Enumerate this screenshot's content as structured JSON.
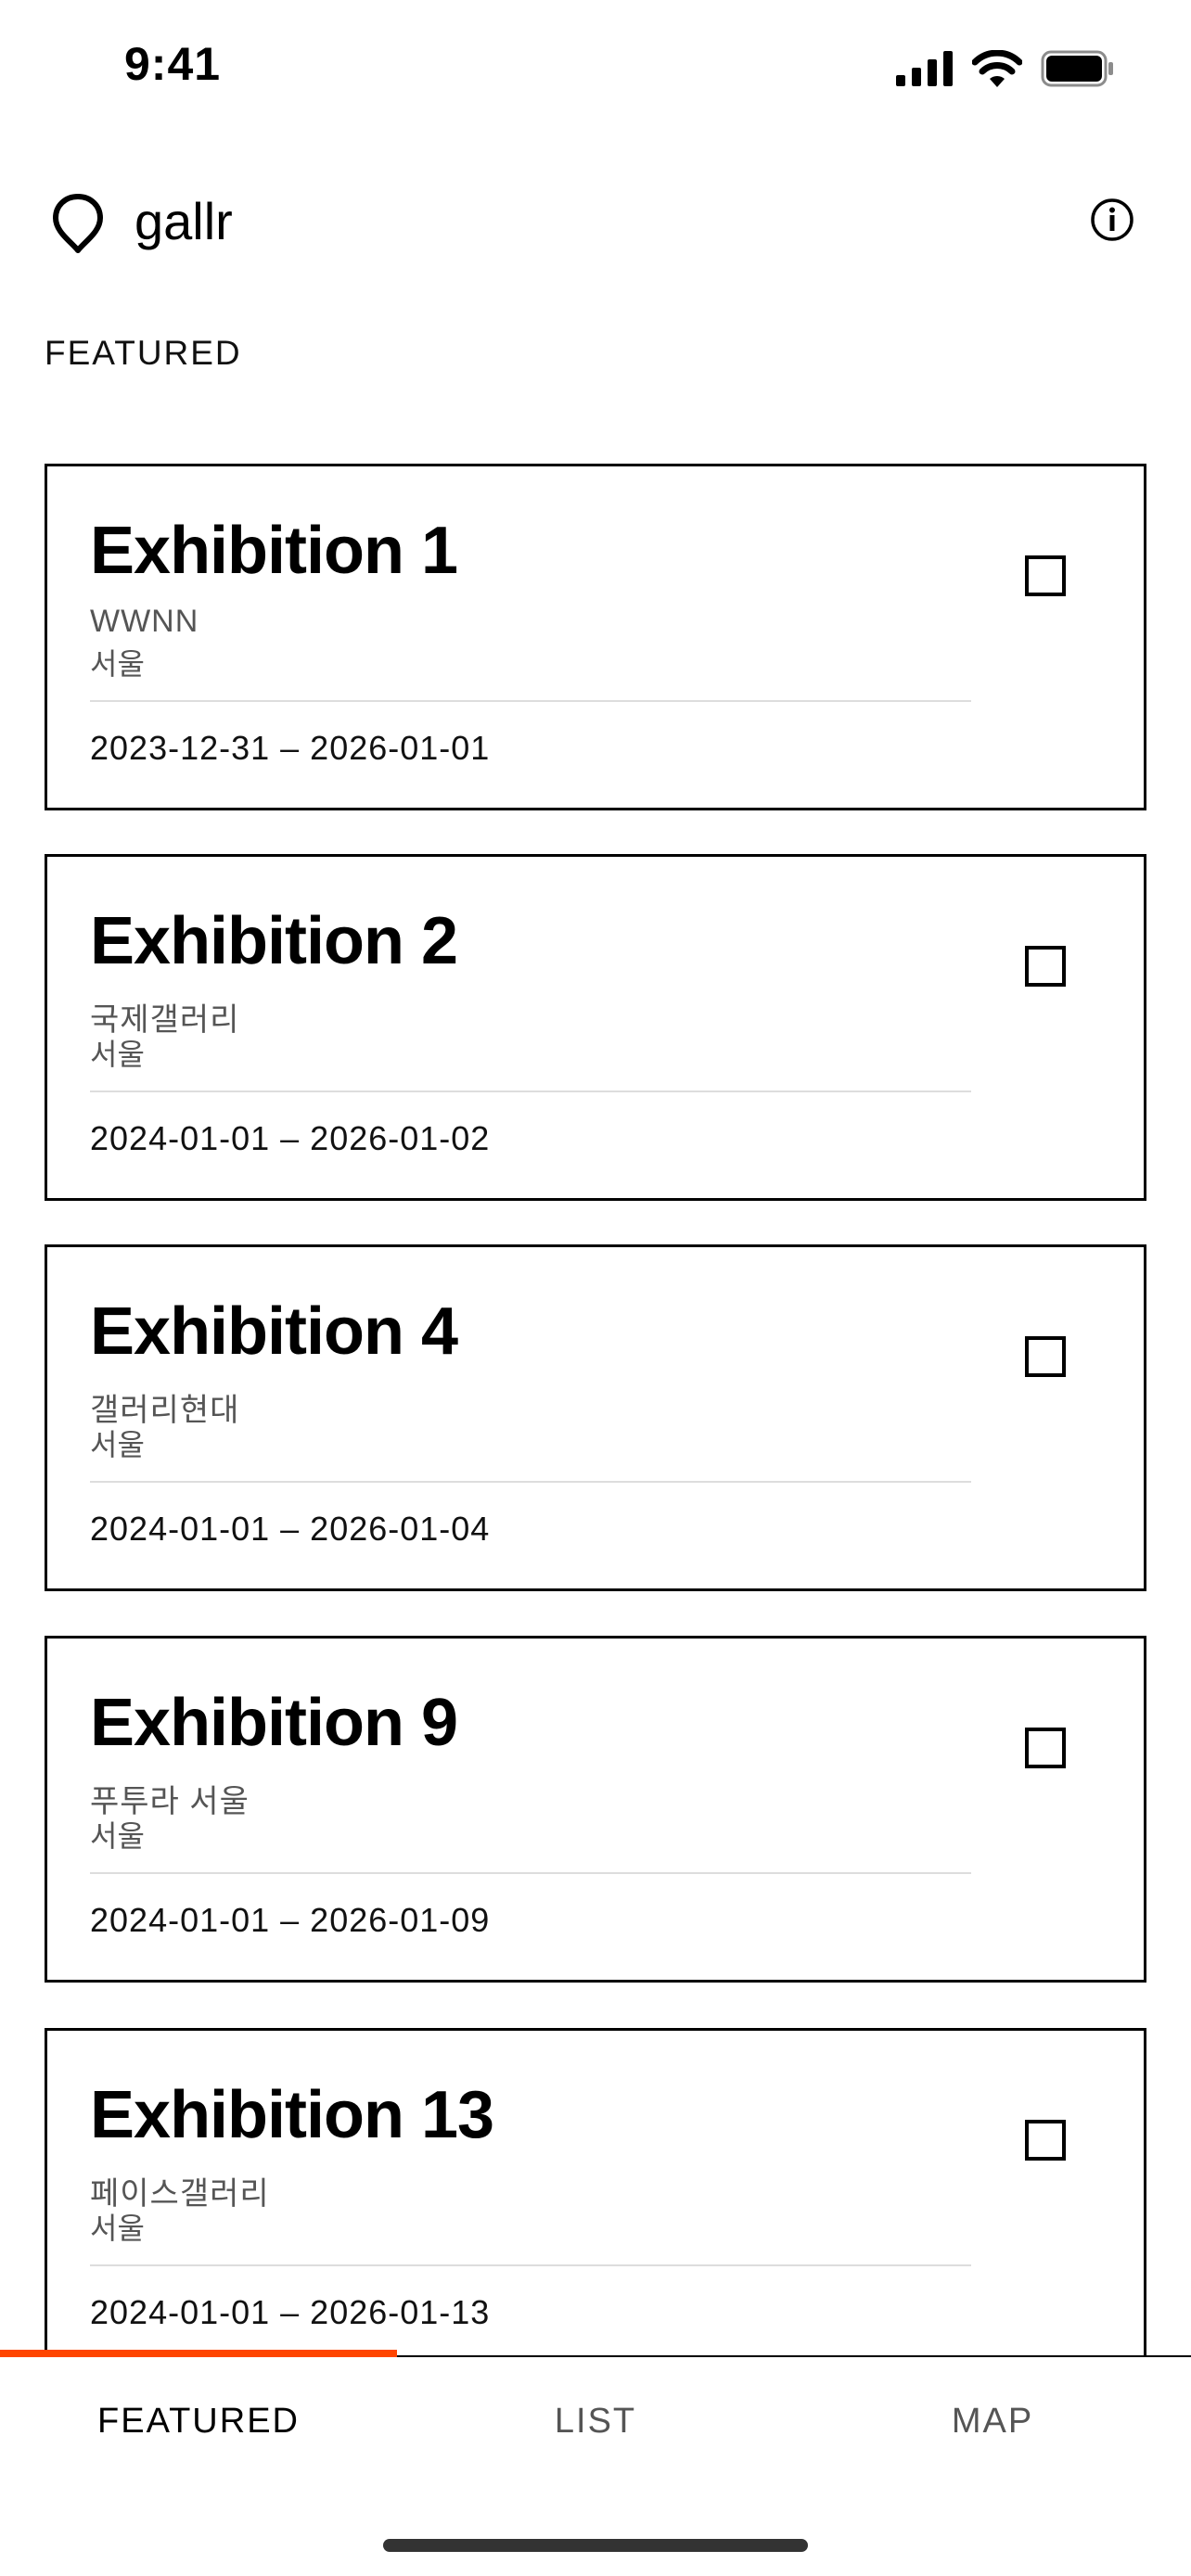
{
  "status_bar": {
    "time": "9:41",
    "icons": [
      "cellular-signal-icon",
      "wifi-icon",
      "battery-icon"
    ]
  },
  "app": {
    "name": "gallr",
    "logo_icon": "location-pin-icon",
    "info_icon": "info-icon"
  },
  "section": {
    "title": "FEATURED"
  },
  "exhibitions": [
    {
      "title": "Exhibition 1",
      "gallery": "WWNN",
      "city": "서울",
      "dates": "2023-12-31 – 2026-01-01",
      "bookmarked": false
    },
    {
      "title": "Exhibition 2",
      "gallery": "국제갤러리",
      "city": "서울",
      "dates": "2024-01-01 – 2026-01-02",
      "bookmarked": false
    },
    {
      "title": "Exhibition 4",
      "gallery": "갤러리현대",
      "city": "서울",
      "dates": "2024-01-01 – 2026-01-04",
      "bookmarked": false
    },
    {
      "title": "Exhibition 9",
      "gallery": "푸투라 서울",
      "city": "서울",
      "dates": "2024-01-01 – 2026-01-09",
      "bookmarked": false
    },
    {
      "title": "Exhibition 13",
      "gallery": "페이스갤러리",
      "city": "서울",
      "dates": "2024-01-01 – 2026-01-13",
      "bookmarked": false
    }
  ],
  "tabs": [
    {
      "label": "FEATURED",
      "active": true
    },
    {
      "label": "LIST",
      "active": false
    },
    {
      "label": "MAP",
      "active": false
    }
  ],
  "colors": {
    "accent": "#ff4500",
    "border": "#000000",
    "muted_text": "#555555"
  }
}
